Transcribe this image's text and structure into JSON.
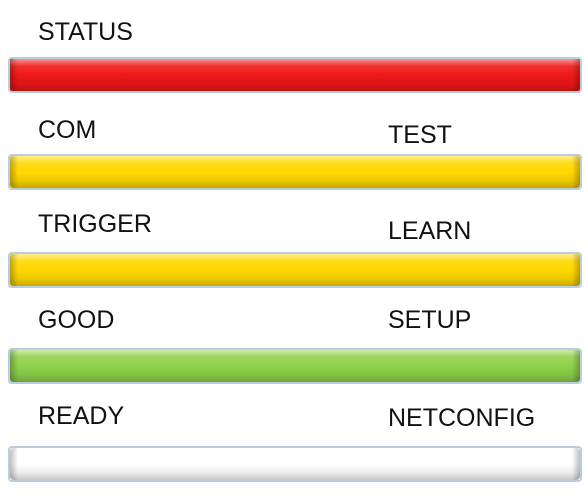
{
  "status": {
    "label": "STATUS",
    "color": "#f01818"
  },
  "rows": [
    {
      "left_label": "COM",
      "right_label": "TEST",
      "color": "#ffd800"
    },
    {
      "left_label": "TRIGGER",
      "right_label": "LEARN",
      "color": "#ffd800"
    },
    {
      "left_label": "GOOD",
      "right_label": "SETUP",
      "color": "#8fd24a"
    },
    {
      "left_label": "READY",
      "right_label": "NETCONFIG",
      "color": "#ffffff"
    }
  ]
}
